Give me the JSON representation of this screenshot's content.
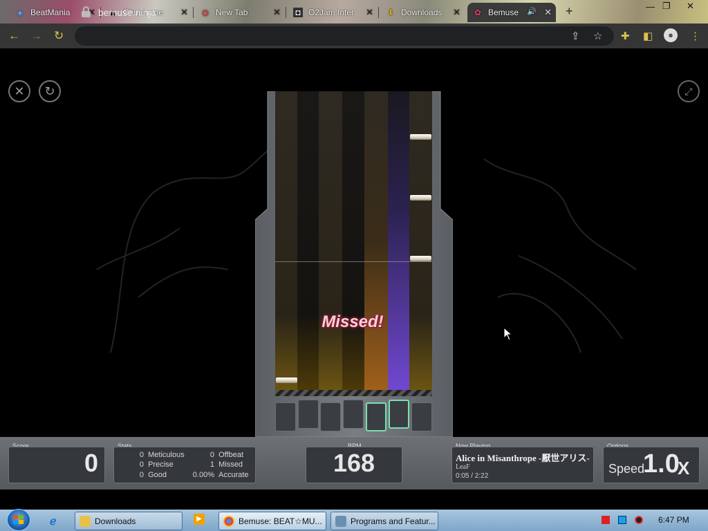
{
  "browser": {
    "tabs": [
      {
        "title": "BeatMania",
        "icon": "beatmania-icon"
      },
      {
        "title": "Chuni.moe",
        "icon": "triangle-icon"
      },
      {
        "title": "New Tab",
        "icon": "chrome-icon"
      },
      {
        "title": "O2Jam Inter",
        "icon": "o2jam-icon"
      },
      {
        "title": "Downloads",
        "icon": "download-icon"
      },
      {
        "title": "Bemuse",
        "icon": "bemuse-icon",
        "active": true,
        "audio": true
      }
    ],
    "url": "bemuse.ninja"
  },
  "game": {
    "judgement": "Missed!",
    "buttons": {
      "exit": "close-circle-icon",
      "restart": "restart-circle-icon",
      "fullscreen": "fullscreen-icon"
    }
  },
  "status": {
    "score_label": "Score",
    "score": "0",
    "stats_label": "Stats",
    "stats": {
      "meticulous_count": "0",
      "meticulous_label": "Meticulous",
      "precise_count": "0",
      "precise_label": "Precise",
      "good_count": "0",
      "good_label": "Good",
      "offbeat_count": "0",
      "offbeat_label": "Offbeat",
      "missed_count": "1",
      "missed_label": "Missed",
      "accuracy": "0.00%",
      "accuracy_label": "Accurate"
    },
    "bpm_label": "BPM",
    "bpm": "168",
    "now_playing_label": "Now Playing",
    "song_title": "Alice in Misanthrope -厭世アリス-",
    "artist": "LeaF",
    "time": "0:05 / 2:22",
    "options_label": "Options",
    "speed_label": "Speed",
    "speed_value": "1.0",
    "speed_suffix": "X"
  },
  "taskbar": {
    "buttons": [
      {
        "label": "Downloads",
        "icon": "folder-icon"
      },
      {
        "label": "Bemuse: BEAT☆MU...",
        "icon": "chrome-icon",
        "active": true
      },
      {
        "label": "Programs and Featur...",
        "icon": "control-panel-icon"
      }
    ],
    "clock": "6:47 PM"
  }
}
